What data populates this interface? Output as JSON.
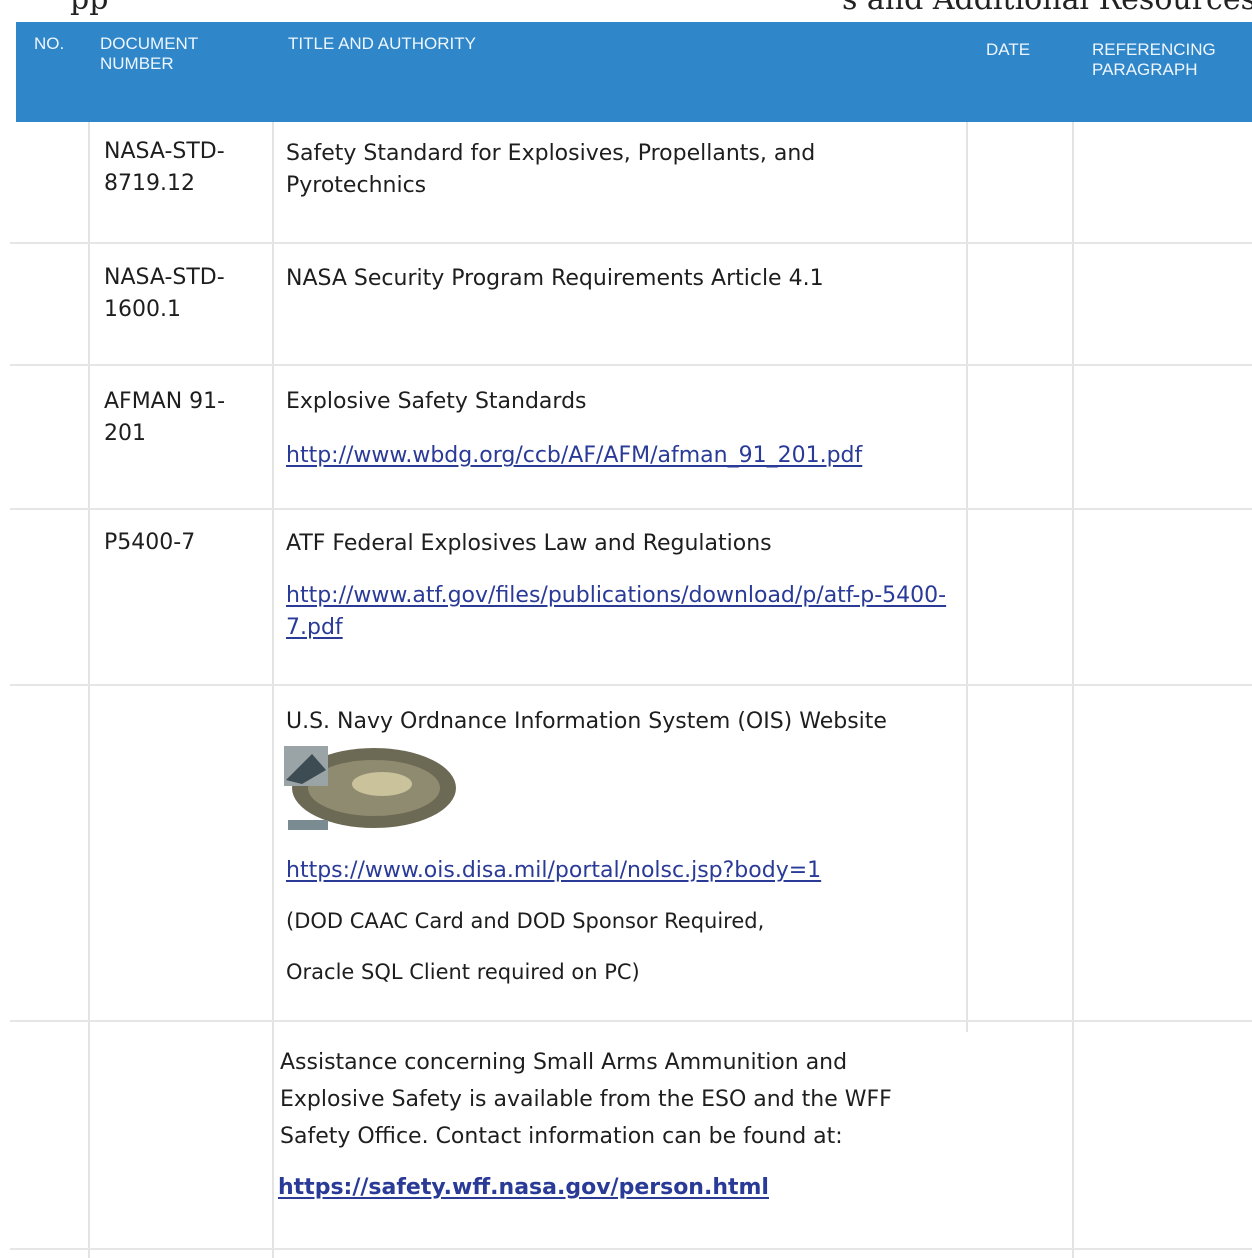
{
  "page_heading": {
    "left": "pp",
    "right": "s and Additional Resources"
  },
  "table": {
    "headers": {
      "no": "NO.",
      "document_number": "DOCUMENT NUMBER",
      "title_authority": "TITLE AND AUTHORITY",
      "date": "DATE",
      "referencing_paragraph": "REFERENCING PARAGRAPH"
    },
    "rows": [
      {
        "doc_number": "NASA-STD-8719.12",
        "title": "Safety Standard for Explosives, Propellants, and Pyrotechnics"
      },
      {
        "doc_number": "NASA-STD-1600.1",
        "title": "NASA Security Program Requirements Article 4.1"
      },
      {
        "doc_number": "AFMAN 91-201",
        "title": "Explosive Safety Standards",
        "link": "http://www.wbdg.org/ccb/AF/AFM/afman_91_201.pdf"
      },
      {
        "doc_number": "P5400-7",
        "title": "ATF Federal Explosives Law and Regulations",
        "link": "http://www.atf.gov/files/publications/download/p/atf-p-5400-7.pdf"
      },
      {
        "doc_number": "",
        "title": "U.S. Navy Ordnance Information System (OIS) Website",
        "link": "https://www.ois.disa.mil/portal/nolsc.jsp?body=1",
        "note1": "(DOD CAAC Card and DOD Sponsor Required,",
        "note2": "Oracle SQL Client required on PC)"
      },
      {
        "doc_number": "",
        "title": "Assistance concerning Small Arms Ammunition and Explosive Safety is available from the ESO and the WFF Safety Office.  Contact information can be found at:",
        "link": "https://safety.wff.nasa.gov/person.html"
      }
    ]
  }
}
